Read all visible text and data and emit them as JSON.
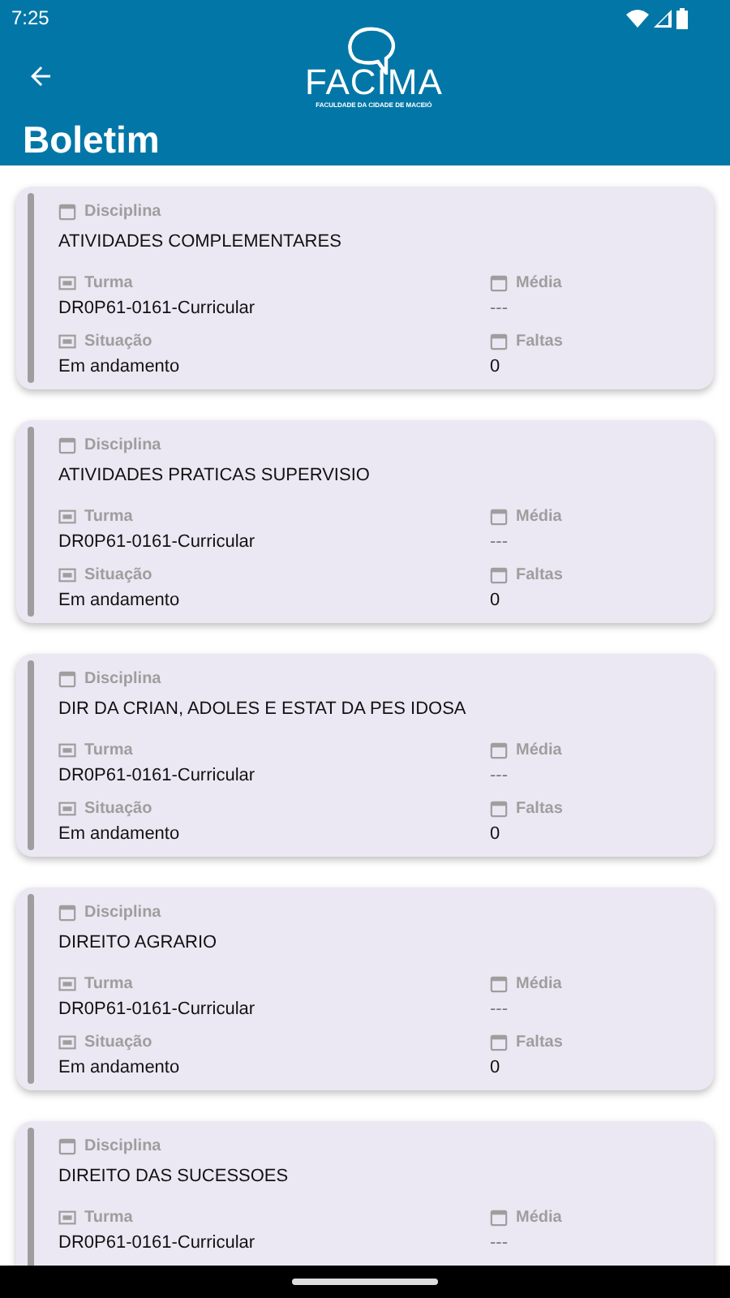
{
  "status_bar": {
    "time": "7:25"
  },
  "header": {
    "logo": {
      "name": "FACIMA",
      "subtitle": "FACULDADE DA CIDADE DE MACEIÓ"
    },
    "title": "Boletim"
  },
  "cards": [
    {
      "disciplina_label": "Disciplina",
      "disciplina": "ATIVIDADES COMPLEMENTARES",
      "turma_label": "Turma",
      "turma": "DR0P61-0161-Curricular",
      "media_label": "Média",
      "media": "---",
      "situacao_label": "Situação",
      "situacao": "Em andamento",
      "faltas_label": "Faltas",
      "faltas": "0"
    },
    {
      "disciplina_label": "Disciplina",
      "disciplina": "ATIVIDADES PRATICAS SUPERVISIO",
      "turma_label": "Turma",
      "turma": "DR0P61-0161-Curricular",
      "media_label": "Média",
      "media": "---",
      "situacao_label": "Situação",
      "situacao": "Em andamento",
      "faltas_label": "Faltas",
      "faltas": "0"
    },
    {
      "disciplina_label": "Disciplina",
      "disciplina": "DIR DA CRIAN, ADOLES E ESTAT DA PES IDOSA",
      "turma_label": "Turma",
      "turma": "DR0P61-0161-Curricular",
      "media_label": "Média",
      "media": "---",
      "situacao_label": "Situação",
      "situacao": "Em andamento",
      "faltas_label": "Faltas",
      "faltas": "0"
    },
    {
      "disciplina_label": "Disciplina",
      "disciplina": "DIREITO AGRARIO",
      "turma_label": "Turma",
      "turma": "DR0P61-0161-Curricular",
      "media_label": "Média",
      "media": "---",
      "situacao_label": "Situação",
      "situacao": "Em andamento",
      "faltas_label": "Faltas",
      "faltas": "0"
    },
    {
      "disciplina_label": "Disciplina",
      "disciplina": "DIREITO DAS SUCESSOES",
      "turma_label": "Turma",
      "turma": "DR0P61-0161-Curricular",
      "media_label": "Média",
      "media": "---"
    }
  ]
}
